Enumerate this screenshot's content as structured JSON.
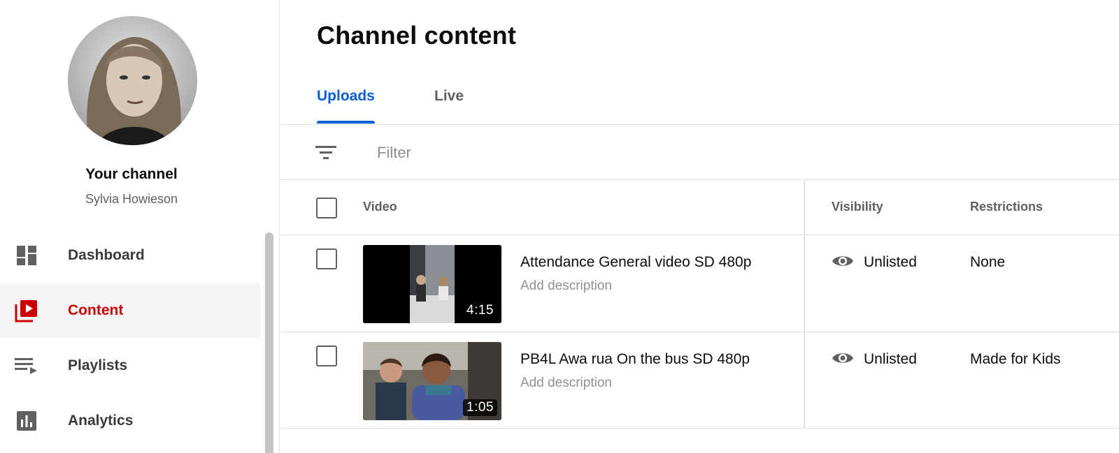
{
  "sidebar": {
    "channel_title": "Your channel",
    "channel_name": "Sylvia Howieson",
    "items": [
      {
        "label": "Dashboard",
        "icon": "dashboard-icon",
        "active": false
      },
      {
        "label": "Content",
        "icon": "content-icon",
        "active": true
      },
      {
        "label": "Playlists",
        "icon": "playlists-icon",
        "active": false
      },
      {
        "label": "Analytics",
        "icon": "analytics-icon",
        "active": false
      }
    ]
  },
  "main": {
    "title": "Channel content",
    "tabs": [
      {
        "label": "Uploads",
        "active": true
      },
      {
        "label": "Live",
        "active": false
      }
    ],
    "filter": {
      "placeholder": "Filter",
      "value": ""
    },
    "columns": {
      "video": "Video",
      "visibility": "Visibility",
      "restrictions": "Restrictions"
    },
    "rows": [
      {
        "title": "Attendance General video SD 480p",
        "description": "Add description",
        "duration": "4:15",
        "visibility": "Unlisted",
        "restrictions": "None"
      },
      {
        "title": "PB4L Awa rua On the bus SD 480p",
        "description": "Add description",
        "duration": "1:05",
        "visibility": "Unlisted",
        "restrictions": "Made for Kids"
      }
    ]
  },
  "colors": {
    "accent_blue": "#065fd4",
    "active_red": "#cc0000",
    "muted_text": "#606060",
    "placeholder_text": "#909090",
    "active_bg": "#f5f5f5"
  }
}
